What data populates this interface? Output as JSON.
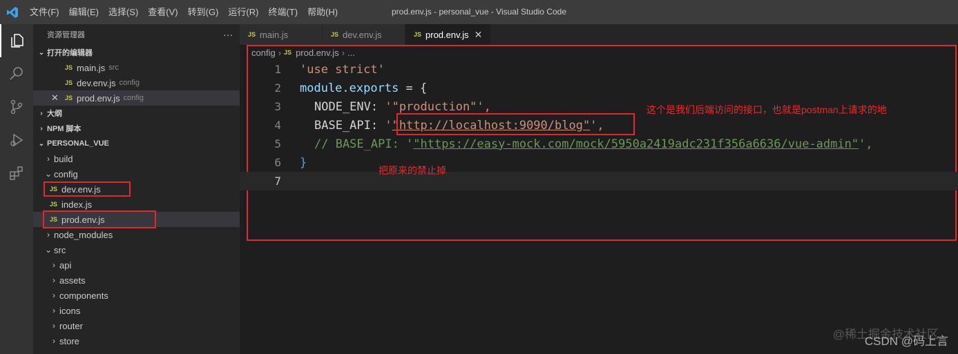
{
  "titlebar": {
    "menus": [
      "文件(F)",
      "编辑(E)",
      "选择(S)",
      "查看(V)",
      "转到(G)",
      "运行(R)",
      "终端(T)",
      "帮助(H)"
    ],
    "window_title": "prod.env.js - personal_vue - Visual Studio Code"
  },
  "sidebar": {
    "title": "资源管理器",
    "more": "···",
    "open_editors": {
      "label": "打开的编辑器",
      "items": [
        {
          "name": "main.js",
          "desc": "src"
        },
        {
          "name": "dev.env.js",
          "desc": "config"
        },
        {
          "name": "prod.env.js",
          "desc": "config",
          "close": "✕"
        }
      ]
    },
    "outline_label": "大纲",
    "npm_label": "NPM 脚本",
    "project_label": "PERSONAL_VUE",
    "tree": {
      "build": "build",
      "config": "config",
      "config_files": [
        "dev.env.js",
        "index.js",
        "prod.env.js"
      ],
      "node_modules": "node_modules",
      "src": "src",
      "src_folders": [
        "api",
        "assets",
        "components",
        "icons",
        "router",
        "store"
      ]
    }
  },
  "tabs": [
    {
      "label": "main.js",
      "active": false
    },
    {
      "label": "dev.env.js",
      "active": false
    },
    {
      "label": "prod.env.js",
      "active": true,
      "close": "✕"
    }
  ],
  "breadcrumb": {
    "folder": "config",
    "file": "prod.env.js",
    "more": "..."
  },
  "code": {
    "line_numbers": [
      "1",
      "2",
      "3",
      "4",
      "5",
      "6",
      "7"
    ],
    "l1": "'use strict'",
    "l2a": "module",
    "l2b": ".exports",
    "l2c": " = {",
    "l3a": "NODE_ENV:",
    "l3b": " '\"production\"',",
    "l4a": "BASE_API:",
    "l4b": "\"http://localhost:9090/blog\"",
    "l4c": "',",
    "l5a": "// BASE_API: '",
    "l5b": "\"https://easy-mock.com/mock/5950a2419adc231f356a6636/vue-admin\"",
    "l5c": "',",
    "l6": "}"
  },
  "annotations": {
    "backend": "这个是我们后端访问的接口，也就是postman上请求的地",
    "disable": "把原来的禁止掉"
  },
  "watermark": {
    "line1": "@稀土掘金技术社区",
    "line2": "CSDN @码上言"
  },
  "colors": {
    "annotation": "#e0282e",
    "accent": "#007acc",
    "js_icon": "#cbcb41"
  }
}
